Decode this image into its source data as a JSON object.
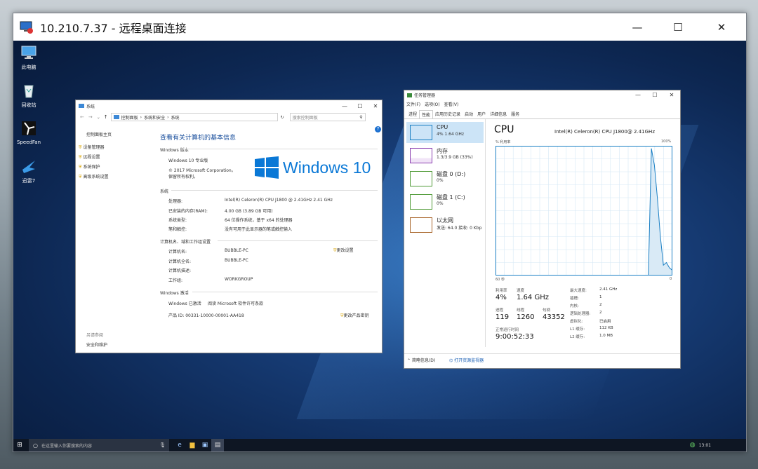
{
  "rdp": {
    "title": "10.210.7.37 - 远程桌面连接",
    "min": "—",
    "max": "☐",
    "close": "✕"
  },
  "desktop_icons": [
    {
      "label": "此电脑",
      "icon": "computer-icon"
    },
    {
      "label": "回收站",
      "icon": "recycle-bin-icon"
    },
    {
      "label": "SpeedFan",
      "icon": "speedfan-icon"
    },
    {
      "label": "迅雷7",
      "icon": "thunder-icon"
    }
  ],
  "system": {
    "title": "系统",
    "breadcrumb": [
      "控制面板",
      "系统和安全",
      "系统"
    ],
    "search_placeholder": "搜索控制面板",
    "side_home": "控制面板主页",
    "side_links": [
      "设备管理器",
      "远程设置",
      "系统保护",
      "高级系统设置"
    ],
    "see_also": "另请参阅",
    "see_also_link": "安全和维护",
    "heading": "查看有关计算机的基本信息",
    "edition_section": "Windows 版本",
    "edition": "Windows 10 专业版",
    "copyright1": "© 2017 Microsoft Corporation。",
    "copyright2": "保留所有权利。",
    "logo_text": "Windows 10",
    "system_section": "系统",
    "rows": [
      {
        "k": "处理器:",
        "v": "Intel(R) Celeron(R) CPU  J1800  @ 2.41GHz   2.41 GHz"
      },
      {
        "k": "已安装的内存(RAM):",
        "v": "4.00 GB (3.89 GB 可用)"
      },
      {
        "k": "系统类型:",
        "v": "64 位操作系统，基于 x64 的处理器"
      },
      {
        "k": "笔和触控:",
        "v": "没有可用于此显示器的笔或触控输入"
      }
    ],
    "name_section": "计算机名、域和工作组设置",
    "name_rows": [
      {
        "k": "计算机名:",
        "v": "BUBBLE-PC"
      },
      {
        "k": "计算机全名:",
        "v": "BUBBLE-PC"
      },
      {
        "k": "计算机描述:",
        "v": ""
      },
      {
        "k": "工作组:",
        "v": "WORKGROUP"
      }
    ],
    "change_settings": "更改设置",
    "activation_section": "Windows 激活",
    "activated": "Windows 已激活",
    "license_link": "阅读 Microsoft 软件许可条款",
    "product_id": "产品 ID: 00331-10000-00001-AA418",
    "change_key": "更改产品密钥"
  },
  "taskmgr": {
    "title": "任务管理器",
    "menu": [
      "文件(F)",
      "选项(O)",
      "查看(V)"
    ],
    "tabs": [
      "进程",
      "性能",
      "应用历史记录",
      "启动",
      "用户",
      "详细信息",
      "服务"
    ],
    "side": [
      {
        "name": "CPU",
        "value": "4% 1.64 GHz",
        "color": "#1a7fc4"
      },
      {
        "name": "内存",
        "value": "1.3/3.9 GB (33%)",
        "color": "#8b3fb0"
      },
      {
        "name": "磁盘 0 (D:)",
        "value": "0%",
        "color": "#4f9a36"
      },
      {
        "name": "磁盘 1 (C:)",
        "value": "0%",
        "color": "#4f9a36"
      },
      {
        "name": "以太网",
        "value": "发送: 64.0  接收: 0 Kbp",
        "color": "#a8652a"
      }
    ],
    "cpu_title": "CPU",
    "cpu_model": "Intel(R) Celeron(R) CPU J1800@ 2.41GHz",
    "util_label": "% 利用率",
    "util_max": "100%",
    "x_left": "60 秒",
    "x_right": "0",
    "stats": {
      "util_l": "利用率",
      "util_v": "4%",
      "speed_l": "速度",
      "speed_v": "1.64 GHz",
      "proc_l": "进程",
      "proc_v": "119",
      "thread_l": "线程",
      "thread_v": "1260",
      "handle_l": "句柄",
      "handle_v": "43352",
      "uptime_l": "正常运行时间",
      "uptime_v": "9:00:52:33"
    },
    "specs": [
      {
        "k": "最大速度:",
        "v": "2.41 GHz"
      },
      {
        "k": "插槽:",
        "v": "1"
      },
      {
        "k": "内核:",
        "v": "2"
      },
      {
        "k": "逻辑处理器:",
        "v": "2"
      },
      {
        "k": "虚拟化:",
        "v": "已启用"
      },
      {
        "k": "L1 缓存:",
        "v": "112 KB"
      },
      {
        "k": "L2 缓存:",
        "v": "1.0 MB"
      }
    ],
    "fewer_details": "简略信息(D)",
    "open_monitor": "打开资源监视器"
  },
  "cpu_history": [
    0,
    0,
    0,
    0,
    0,
    0,
    0,
    0,
    0,
    0,
    0,
    0,
    0,
    0,
    0,
    0,
    0,
    0,
    0,
    0,
    0,
    0,
    0,
    0,
    0,
    0,
    0,
    0,
    0,
    0,
    0,
    0,
    0,
    0,
    0,
    0,
    0,
    0,
    0,
    0,
    0,
    0,
    0,
    0,
    0,
    0,
    0,
    0,
    0,
    0,
    0,
    0,
    98,
    85,
    60,
    30,
    8,
    10,
    6,
    4
  ],
  "taskbar": {
    "search_placeholder": "在这里输入你要搜索的内容",
    "clock": "13:01"
  }
}
